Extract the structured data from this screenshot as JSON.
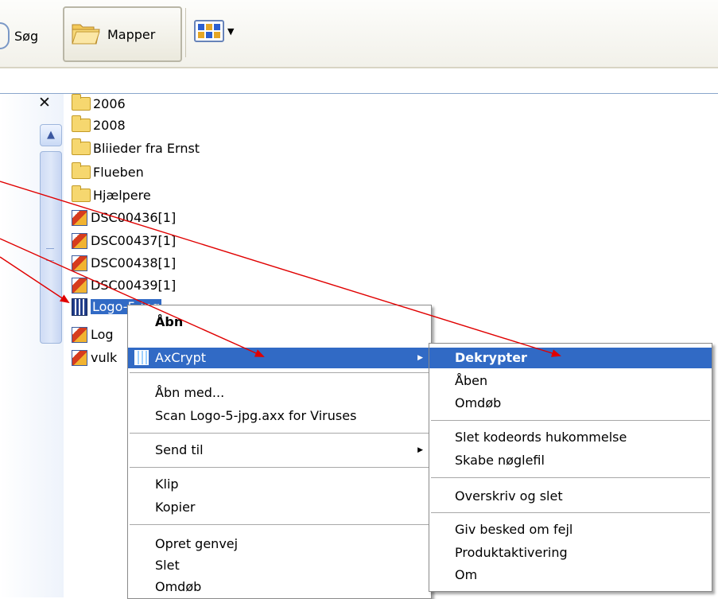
{
  "toolbar": {
    "search_label": "Søg",
    "folders_label": "Mapper",
    "views_icon": "views-icon"
  },
  "files": [
    {
      "name": "2006",
      "type": "folder"
    },
    {
      "name": "2008",
      "type": "folder"
    },
    {
      "name": "Bliieder fra Ernst",
      "type": "folder"
    },
    {
      "name": "Flueben",
      "type": "folder"
    },
    {
      "name": "Hjælpere",
      "type": "folder"
    },
    {
      "name": "DSC00436[1]",
      "type": "image"
    },
    {
      "name": "DSC00437[1]",
      "type": "image"
    },
    {
      "name": "DSC00438[1]",
      "type": "image"
    },
    {
      "name": "DSC00439[1]",
      "type": "image"
    },
    {
      "name": "Logo-5-jpg",
      "type": "axx"
    },
    {
      "name": "Log",
      "type": "image"
    },
    {
      "name": "vulk",
      "type": "image"
    }
  ],
  "context_menu": {
    "open": "Åbn",
    "axcrypt": "AxCrypt",
    "open_with": "Åbn med...",
    "scan": "Scan Logo-5-jpg.axx for Viruses",
    "send_to": "Send til",
    "cut": "Klip",
    "copy": "Kopier",
    "create_shortcut": "Opret genvej",
    "delete": "Slet",
    "rename": "Omdøb"
  },
  "axcrypt_menu": {
    "decrypt": "Dekrypter",
    "open": "Åben",
    "rename": "Omdøb",
    "clear_passphrase_memory": "Slet kodeords hukommelse",
    "make_keyfile": "Skabe nøglefil",
    "wipe": "Overskriv og slet",
    "report_error": "Giv besked om fejl",
    "product_activation": "Produktaktivering",
    "about": "Om"
  },
  "colors": {
    "selection": "#316ac5",
    "annotation_arrow": "#e00000"
  }
}
